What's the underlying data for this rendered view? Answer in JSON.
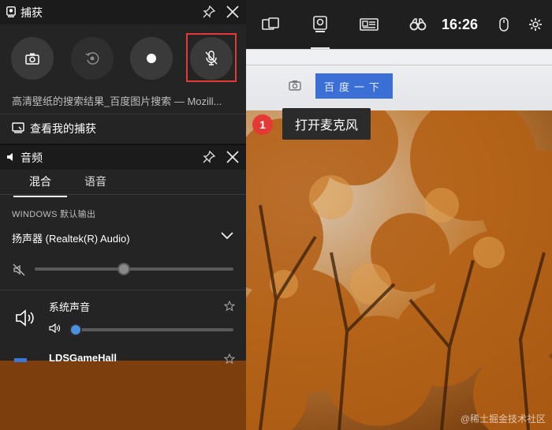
{
  "capture_panel": {
    "title": "捕获",
    "now_capturing": "高清壁纸的搜索结果_百度图片搜索 — Mozill...",
    "view_captures": "查看我的捕获"
  },
  "audio_panel": {
    "title": "音频",
    "tabs": [
      {
        "label": "混合",
        "active": true
      },
      {
        "label": "语音",
        "active": false
      }
    ],
    "section_label": "WINDOWS 默认输出",
    "output_device": "扬声器 (Realtek(R) Audio)",
    "master_volume": 0.45,
    "apps": [
      {
        "name": "系统声音",
        "volume": 0.02
      },
      {
        "name": "LDSGameHall"
      }
    ]
  },
  "game_bar": {
    "time": "16:26",
    "icons": [
      "widget-menu-icon",
      "capture-widget-icon",
      "performance-icon",
      "looking-for-group-icon",
      "mouse-icon",
      "settings-icon"
    ],
    "active_item": "capture-widget-icon"
  },
  "browser": {
    "search_button": "百度一下"
  },
  "annotation": {
    "number": "1",
    "text": "打开麦克风",
    "highlight_color": "#e53935"
  },
  "watermark": "@稀土掘金技术社区"
}
